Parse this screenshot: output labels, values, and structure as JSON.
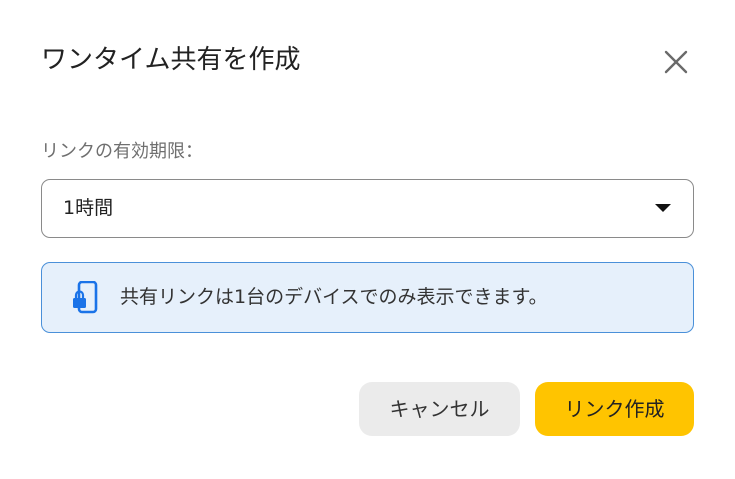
{
  "dialog": {
    "title": "ワンタイム共有を作成",
    "close_icon": "close-icon"
  },
  "expiry": {
    "label": "リンクの有効期限：",
    "selected": "1時間",
    "dropdown_icon": "caret-down-icon"
  },
  "notice": {
    "icon": "phone-lock-icon",
    "text": "共有リンクは1台のデバイスでのみ表示できます。",
    "accent_color": "#1a73e8"
  },
  "actions": {
    "cancel_label": "キャンセル",
    "create_label": "リンク作成",
    "create_color": "#ffc400"
  }
}
